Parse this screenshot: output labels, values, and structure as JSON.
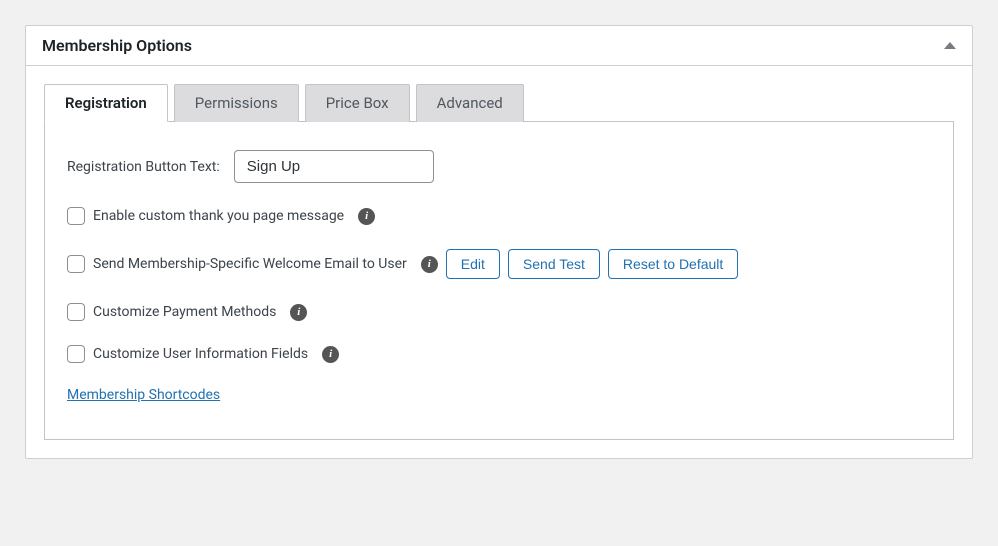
{
  "panel": {
    "title": "Membership Options"
  },
  "tabs": [
    {
      "label": "Registration",
      "active": true
    },
    {
      "label": "Permissions",
      "active": false
    },
    {
      "label": "Price Box",
      "active": false
    },
    {
      "label": "Advanced",
      "active": false
    }
  ],
  "registration": {
    "button_text_label": "Registration Button Text:",
    "button_text_value": "Sign Up",
    "options": {
      "thank_you": {
        "label": "Enable custom thank you page message",
        "checked": false
      },
      "welcome_email": {
        "label": "Send Membership-Specific Welcome Email to User",
        "checked": false,
        "buttons": {
          "edit": "Edit",
          "send_test": "Send Test",
          "reset": "Reset to Default"
        }
      },
      "payment_methods": {
        "label": "Customize Payment Methods",
        "checked": false
      },
      "user_fields": {
        "label": "Customize User Information Fields",
        "checked": false
      }
    },
    "shortcodes_link": "Membership Shortcodes"
  }
}
